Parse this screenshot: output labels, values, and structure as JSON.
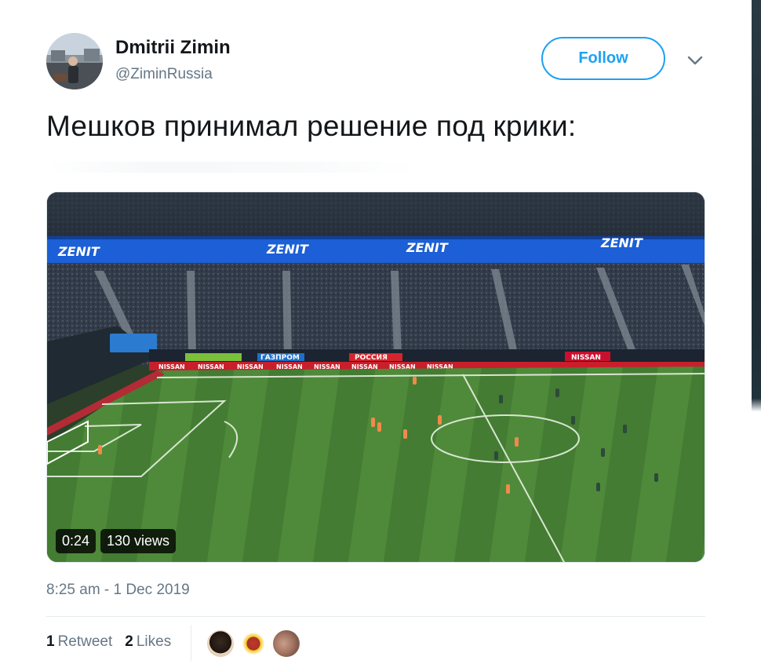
{
  "author": {
    "name": "Dmitrii Zimin",
    "handle": "@ZiminRussia"
  },
  "follow_label": "Follow",
  "tweet": {
    "text": "Мешков принимал решение под крики:"
  },
  "video": {
    "duration": "0:24",
    "views": "130 views",
    "stadium_banner": "ZENIT",
    "ad_boards": [
      "NISSAN",
      "ГАЗПРОМ",
      "РОССИЯ",
      "NISSAN",
      "NISSAN"
    ]
  },
  "timestamp": "8:25 am - 1 Dec 2019",
  "stats": {
    "retweets_count": "1",
    "retweets_label": "Retweet",
    "likes_count": "2",
    "likes_label": "Likes"
  },
  "colors": {
    "accent": "#1da1f2",
    "secondary_text": "#657786",
    "pitch_light": "#4f8a3a",
    "pitch_dark": "#3f7530",
    "banner": "#1c5fd6"
  },
  "icons": [
    "chevron-down-icon",
    "play-video"
  ]
}
